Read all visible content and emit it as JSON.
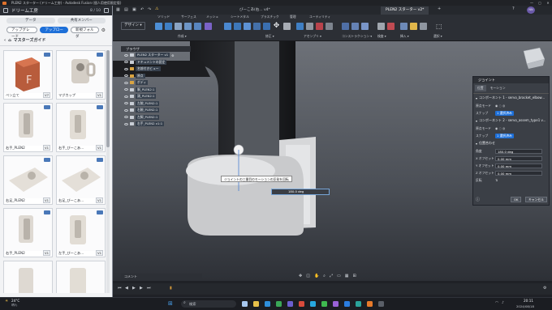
{
  "window": {
    "title": "PLEN2 スターター (ドリーム工房) - Autodesk Fusion (個人用使用限定版)",
    "controls": [
      "—",
      "▢",
      "✕"
    ]
  },
  "left_panel": {
    "team": "ドリーム工房",
    "count": "8 / 10",
    "tabs": [
      "データ",
      "共有メンバー"
    ],
    "actions": {
      "upgrade": "アップグレード",
      "upload": "アップロード",
      "new_folder": "新規フォルダ"
    },
    "breadcrumb": "マスターズガイド",
    "items": [
      {
        "label": "ペン立て",
        "version": "V7"
      },
      {
        "label": "マグカップ",
        "version": "V1"
      },
      {
        "label": "右手_PLEN2",
        "version": "V1"
      },
      {
        "label": "右手_びーこあ...",
        "version": "V1"
      },
      {
        "label": "右足_PLEN2",
        "version": "V1"
      },
      {
        "label": "右足_びーこあ...",
        "version": "V1"
      },
      {
        "label": "右手_PLEN2",
        "version": "V1"
      },
      {
        "label": "左手_びーこあ...",
        "version": "V1"
      },
      {
        "label": "",
        "version": ""
      },
      {
        "label": "",
        "version": ""
      }
    ]
  },
  "tabs": [
    {
      "label": "びーこあ(右... v4*"
    },
    {
      "label": "PLEN2 スターター v2*"
    }
  ],
  "toolbar": {
    "design_label": "デザイン ▾",
    "groups": [
      "ソリッド",
      "サーフェス",
      "メッシュ",
      "シートメタル",
      "プラスチック",
      "管理",
      "ユーティリティ"
    ],
    "sections": [
      "作成 ▾",
      "修正 ▾",
      "アセンブリ ▾",
      "コンストラクション ▾",
      "検査 ▾",
      "挿入 ▾",
      "選択 ▾"
    ]
  },
  "browser": {
    "title": "ブラウザ",
    "root": "PLEN2 スターター v1",
    "rows": [
      "ドキュメントの設定",
      "名前付きビュー",
      "原点",
      "ボディ",
      "胴_PLEN2:1",
      "頭_PLEN2:1",
      "左腕_PLEN2:1",
      "右腕_PLEN2:1",
      "左脚_PLEN2:1",
      "右手_PLEN2 v1:1"
    ]
  },
  "viewport": {
    "tooltip": "ジョイントの三番目のモーションの反発を回転",
    "angle_value": "180.0 deg"
  },
  "joint_panel": {
    "title": "ジョイント",
    "tabs": [
      "位置",
      "モーション"
    ],
    "component1": "コンポーネント 1 - servo_bracket_elbow...",
    "component2": "コンポーネント 2 - servo_assem_type1 v...",
    "snap_label": "スナップ",
    "snap_value": "1 選択済み",
    "origin_mode_label": "原点モード",
    "alignment_title": "位置合わせ",
    "angle_label": "角度",
    "angle": "180.0 deg",
    "x_label": "X オフセット",
    "x_offset": "0.00 mm",
    "y_label": "Y オフセット",
    "y_offset": "0.00 mm",
    "z_label": "Z オフセット",
    "z_offset": "0.00 mm",
    "flip_label": "反転",
    "ok": "OK",
    "cancel": "キャンセル"
  },
  "bottom": {
    "comments": "コメント",
    "timeline_controls": [
      "⏮",
      "◀",
      "▶",
      "▶",
      "⏭"
    ]
  },
  "taskbar": {
    "weather": "24°C",
    "weather_sub": "晴れ",
    "search": "検索",
    "time": "20:11",
    "date": "2024/08/18"
  }
}
